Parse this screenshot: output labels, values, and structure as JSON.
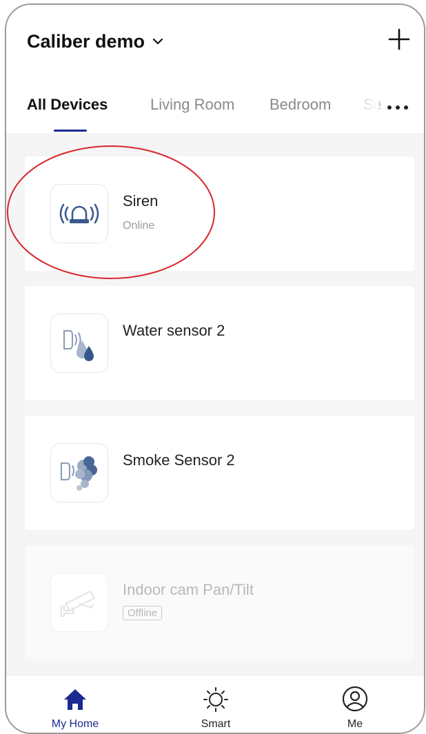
{
  "header": {
    "home_name": "Caliber demo",
    "add_icon": "plus-icon"
  },
  "tabs": [
    {
      "label": "All Devices",
      "active": true
    },
    {
      "label": "Living Room",
      "active": false
    },
    {
      "label": "Bedroom",
      "active": false
    },
    {
      "label": "Se",
      "active": false
    }
  ],
  "more_icon": "more-dots-icon",
  "devices": [
    {
      "name": "Siren",
      "status": "Online",
      "icon": "siren-icon"
    },
    {
      "name": "Water sensor 2",
      "status": "",
      "icon": "water-sensor-icon"
    },
    {
      "name": "Smoke Sensor 2",
      "status": "",
      "icon": "smoke-sensor-icon"
    },
    {
      "name": "Indoor cam Pan/Tilt",
      "status": "Offline",
      "icon": "camera-icon"
    }
  ],
  "tabbar": [
    {
      "label": "My Home",
      "icon": "home-icon",
      "active": true
    },
    {
      "label": "Smart",
      "icon": "sun-icon",
      "active": false
    },
    {
      "label": "Me",
      "icon": "user-icon",
      "active": false
    }
  ],
  "colors": {
    "accent": "#1b2a8f",
    "icon_blue": "#3a5a8c",
    "annotation": "#d9262c",
    "background": "#f5f5f5"
  }
}
